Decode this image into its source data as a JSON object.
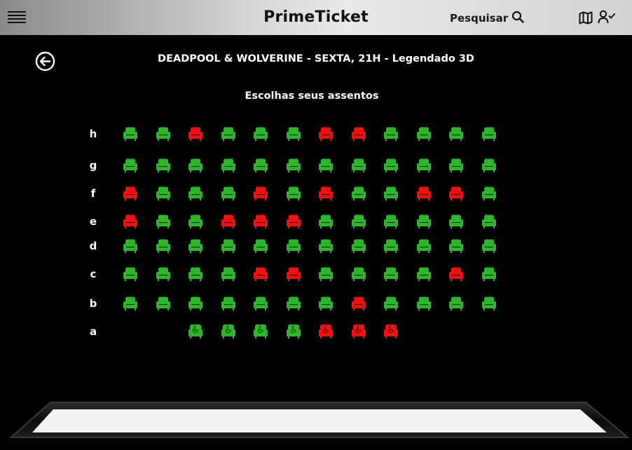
{
  "header": {
    "brand": "PrimeTicket",
    "search_label": "Pesquisar",
    "icons": [
      "menu-icon",
      "search-icon",
      "map-icon",
      "user-check-icon"
    ]
  },
  "session": {
    "title": "DEADPOOL & WOLVERINE - SEXTA, 21H - Legendado 3D",
    "prompt": "Escolhas seus assentos",
    "back_icon": "arrow-left-circle-icon"
  },
  "colors": {
    "available": "#2db52d",
    "occupied": "#ee1111",
    "header_bg": "#d6d6d6",
    "background": "#000000"
  },
  "legend": {
    "A": "available seat",
    "X": "occupied seat",
    "W": "available wheelchair seat",
    "Y": "occupied wheelchair seat",
    ".": "no seat"
  },
  "seating": {
    "rows": [
      {
        "label": "h",
        "seats": "AAXAAAXXAAAA"
      },
      {
        "label": "g",
        "seats": "AAAAAAAAAAAA"
      },
      {
        "label": "f",
        "seats": "XAAAXAXAAXXA"
      },
      {
        "label": "e",
        "seats": "XAAXXXAAAAAA"
      },
      {
        "label": "d",
        "seats": "AAAAAAAAAAAA"
      },
      {
        "label": "c",
        "seats": "AAAAXXAAAAXA"
      },
      {
        "label": "b",
        "seats": "AAAAAAAXAAAA"
      },
      {
        "label": "a",
        "seats": "..WWWWYYY..."
      }
    ]
  }
}
